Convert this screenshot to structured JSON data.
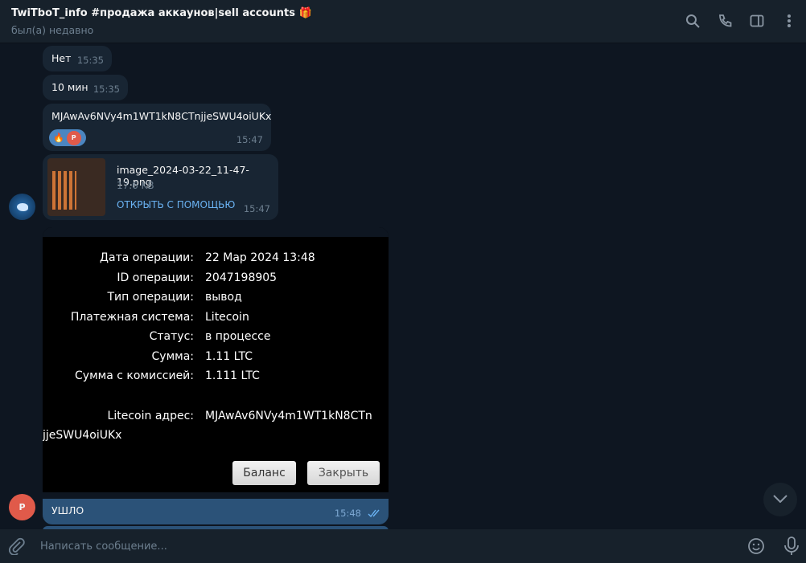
{
  "header": {
    "title": "TwiTboT_info #продажа аккаунов|sell accounts 🎁",
    "status": "был(а) недавно"
  },
  "messages": [
    {
      "text": "Нет",
      "time": "15:35"
    },
    {
      "text": "10 мин",
      "time": "15:35"
    },
    {
      "text": "MJAwAv6NVy4m1WT1kN8CTnjjeSWU4oiUKx",
      "time": "15:47",
      "reaction": "🔥",
      "reaction_user": "Р"
    },
    {
      "file_name": "image_2024-03-22_11-47-19.png",
      "file_size": "17.6 KB",
      "open_with": "ОТКРЫТЬ С ПОМОЩЬЮ",
      "time": "15:47"
    }
  ],
  "screenshot": {
    "rows": [
      {
        "k": "Дата операции:",
        "v": "22 Мар 2024 13:48"
      },
      {
        "k": "ID операции:",
        "v": "2047198905"
      },
      {
        "k": "Тип операции:",
        "v": "вывод"
      },
      {
        "k": "Платежная система:",
        "v": "Litecoin"
      },
      {
        "k": "Статус:",
        "v": "в процессе"
      },
      {
        "k": "Сумма:",
        "v": "1.11 LTC"
      },
      {
        "k": "Сумма с комиссией:",
        "v": "1.111 LTC"
      }
    ],
    "address_label": "Litecoin адрес:",
    "address_1": "MJAwAv6NVy4m1WT1kN8CTn",
    "address_2": "jjeSWU4oiUKx",
    "balance_btn": "Баланс",
    "close_btn": "Закрыть"
  },
  "outgoing": {
    "text": "УШЛО",
    "time": "15:48",
    "avatar": "Р"
  },
  "input": {
    "placeholder": "Написать сообщение..."
  }
}
